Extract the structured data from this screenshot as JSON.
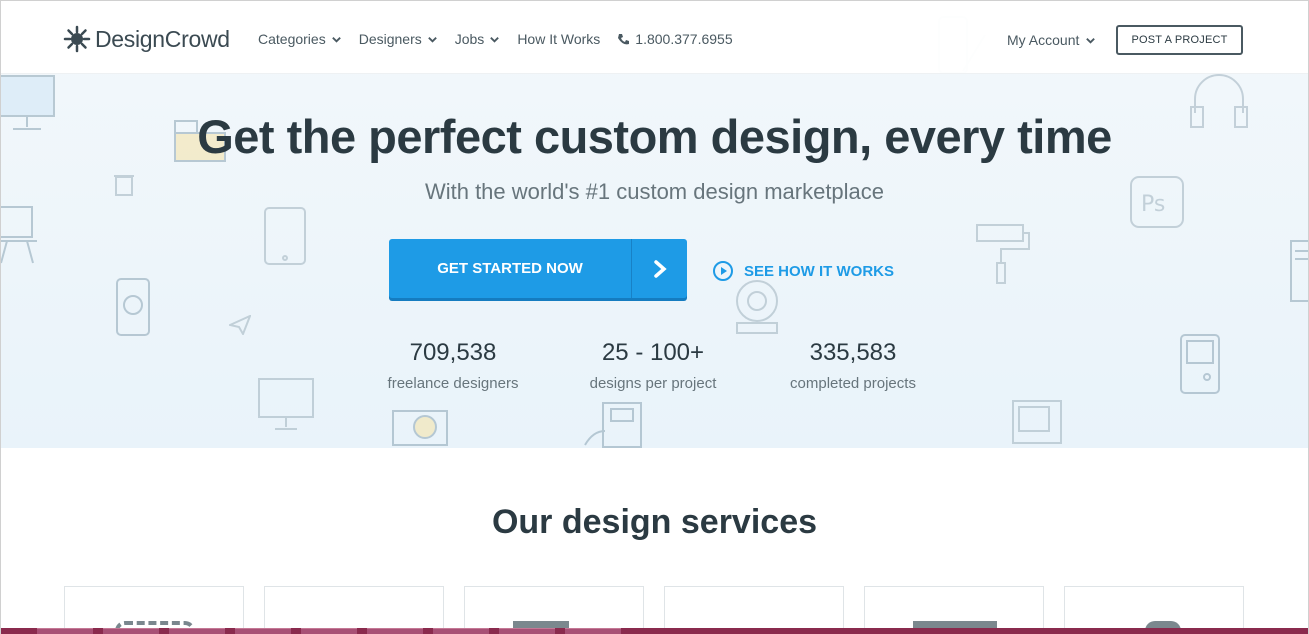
{
  "header": {
    "logo_text": "DesignCrowd",
    "nav": [
      "Categories",
      "Designers",
      "Jobs"
    ],
    "how_it_works": "How It Works",
    "phone": "1.800.377.6955",
    "account": "My Account",
    "post_project": "POST A PROJECT"
  },
  "hero": {
    "title": "Get the perfect custom design, every time",
    "subtitle": "With the world's #1 custom design marketplace",
    "cta": "GET STARTED NOW",
    "how_link": "SEE HOW IT WORKS",
    "stats": [
      {
        "value": "709,538",
        "label": "freelance designers"
      },
      {
        "value": "25 - 100+",
        "label": "designs per project"
      },
      {
        "value": "335,583",
        "label": "completed projects"
      }
    ]
  },
  "services": {
    "title": "Our design services"
  },
  "colors": {
    "primary": "#1e9be6",
    "text_dark": "#2b3a42",
    "text_muted": "#67757c",
    "taskbar": "#8a2a4d"
  },
  "icons": [
    "logo-mark-icon",
    "chevron-down-icon",
    "phone-icon",
    "arrow-right-icon",
    "play-circle-icon"
  ]
}
